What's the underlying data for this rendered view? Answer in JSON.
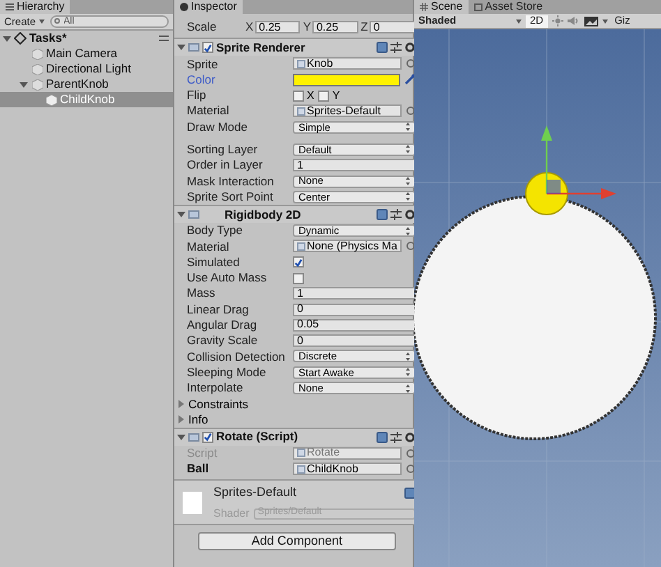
{
  "hierarchy": {
    "tab": "Hierarchy",
    "create": "Create",
    "placeholder": "All",
    "scene": "Tasks*",
    "items": [
      {
        "label": "Main Camera",
        "selected": false
      },
      {
        "label": "Directional Light",
        "selected": false
      },
      {
        "label": "ParentKnob",
        "selected": false,
        "expanded": true,
        "children": [
          {
            "label": "ChildKnob",
            "selected": true
          }
        ]
      }
    ]
  },
  "inspector": {
    "tab": "Inspector",
    "scale": {
      "label": "Scale",
      "fields": [
        {
          "axis": "X",
          "value": "0.25"
        },
        {
          "axis": "Y",
          "value": "0.25"
        },
        {
          "axis": "Z",
          "value": "0"
        }
      ]
    },
    "components": [
      {
        "title": "Sprite Renderer",
        "enabled": true,
        "expanded": true,
        "sections": [
          [
            {
              "kind": "object",
              "label": "Sprite",
              "value": "Knob"
            },
            {
              "kind": "color",
              "label": "Color",
              "color": "#fff200"
            },
            {
              "kind": "flip",
              "label": "Flip",
              "options": [
                {
                  "label": "X",
                  "checked": false
                },
                {
                  "label": "Y",
                  "checked": false
                }
              ]
            },
            {
              "kind": "object",
              "label": "Material",
              "value": "Sprites-Default"
            },
            {
              "kind": "dropdown",
              "label": "Draw Mode",
              "value": "Simple"
            }
          ],
          [
            {
              "kind": "dropdown",
              "label": "Sorting Layer",
              "value": "Default"
            },
            {
              "kind": "number",
              "label": "Order in Layer",
              "value": "1"
            },
            {
              "kind": "dropdown",
              "label": "Mask Interaction",
              "value": "None"
            },
            {
              "kind": "dropdown",
              "label": "Sprite Sort Point",
              "value": "Center"
            }
          ]
        ]
      },
      {
        "title": "Rigidbody 2D",
        "expanded": true,
        "sections": [
          [
            {
              "kind": "dropdown",
              "label": "Body Type",
              "value": "Dynamic"
            },
            {
              "kind": "object",
              "label": "Material",
              "value": "None (Physics Ma"
            },
            {
              "kind": "checkbox",
              "label": "Simulated",
              "checked": true
            },
            {
              "kind": "checkbox",
              "label": "Use Auto Mass",
              "checked": false
            },
            {
              "kind": "number",
              "label": "Mass",
              "value": "1"
            },
            {
              "kind": "number",
              "label": "Linear Drag",
              "value": "0"
            },
            {
              "kind": "number",
              "label": "Angular Drag",
              "value": "0.05"
            },
            {
              "kind": "number",
              "label": "Gravity Scale",
              "value": "0"
            },
            {
              "kind": "dropdown",
              "label": "Collision Detection",
              "value": "Discrete"
            },
            {
              "kind": "dropdown",
              "label": "Sleeping Mode",
              "value": "Start Awake"
            },
            {
              "kind": "dropdown",
              "label": "Interpolate",
              "value": "None"
            },
            {
              "kind": "foldout",
              "label": "Constraints"
            },
            {
              "kind": "foldout",
              "label": "Info"
            }
          ]
        ]
      },
      {
        "title": "Rotate (Script)",
        "enabled": true,
        "expanded": true,
        "sections": [
          [
            {
              "kind": "object",
              "label": "Script",
              "value": "Rotate",
              "disabled": true
            },
            {
              "kind": "object",
              "label": "Ball",
              "value": "ChildKnob",
              "bold": true
            }
          ]
        ]
      }
    ],
    "material": {
      "name": "Sprites-Default",
      "shader_label": "Shader",
      "shader": "Sprites/Default"
    },
    "add_component": "Add Component"
  },
  "scene": {
    "tabs": [
      {
        "label": "Scene",
        "selected": true
      },
      {
        "label": "Asset Store",
        "selected": false
      }
    ],
    "shading": "Shaded",
    "mode_2d": "2D",
    "mode_2d_on": true,
    "gizmos": "Giz"
  }
}
